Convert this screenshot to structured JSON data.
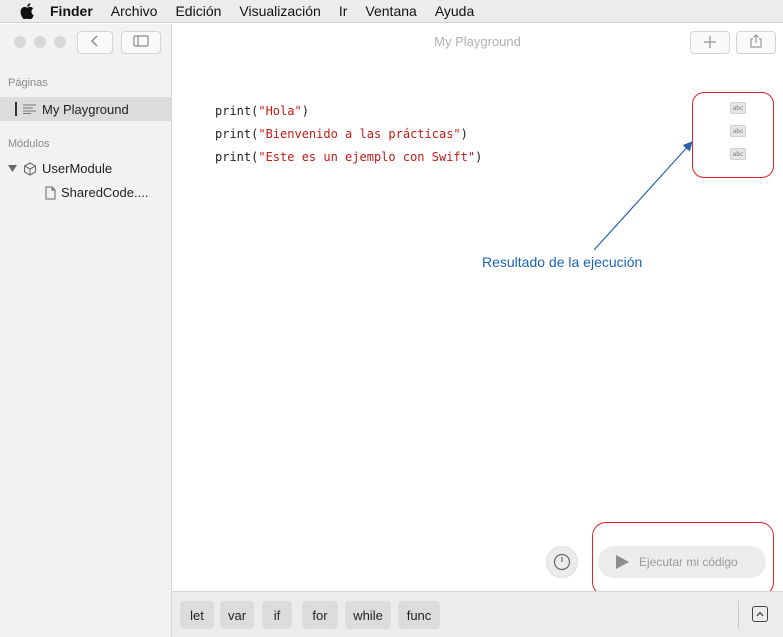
{
  "menubar": {
    "items": [
      "Finder",
      "Archivo",
      "Edición",
      "Visualización",
      "Ir",
      "Ventana",
      "Ayuda"
    ]
  },
  "window": {
    "title": "My Playground"
  },
  "sidebar": {
    "pages_header": "Páginas",
    "pages": [
      {
        "label": "My Playground"
      }
    ],
    "modules_header": "Módulos",
    "modules": [
      {
        "label": "UserModule",
        "icon": "cube-icon",
        "expanded": true
      },
      {
        "label": "SharedCode....",
        "icon": "document-icon"
      }
    ]
  },
  "editor": {
    "lines": [
      {
        "fn": "print(",
        "str": "\"Hola\"",
        "end": ")"
      },
      {
        "fn": "print(",
        "str": "\"Bienvenido a las prácticas\"",
        "end": ")"
      },
      {
        "fn": "print(",
        "str": "\"Este es un ejemplo con Swift\"",
        "end": ")"
      }
    ],
    "result_badges": [
      "abc",
      "abc",
      "abc"
    ]
  },
  "annotation": {
    "text": "Resultado de la ejecución",
    "color": "#1b63b8",
    "highlight_color": "#e0202a"
  },
  "run": {
    "label": "Ejecutar mi código"
  },
  "keywords": [
    "let",
    "var",
    "if",
    "for",
    "while",
    "func"
  ]
}
